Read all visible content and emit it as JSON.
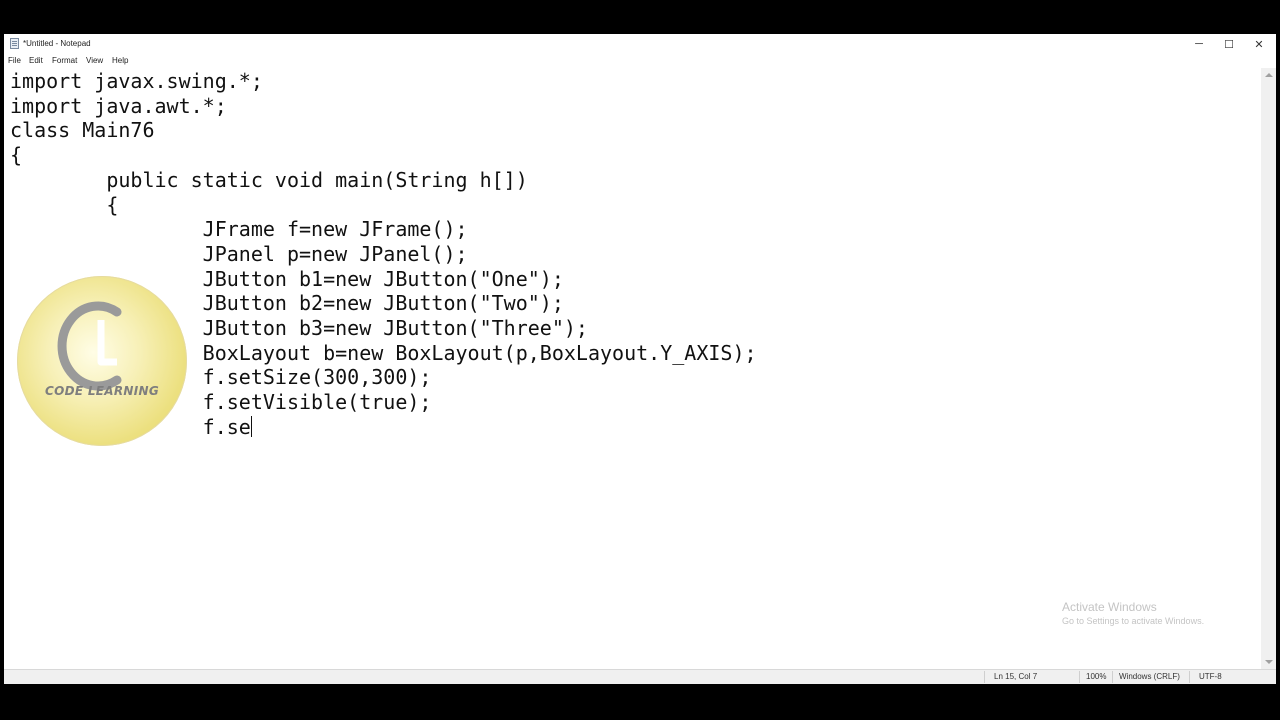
{
  "window": {
    "title": "*Untitled - Notepad"
  },
  "controls": {
    "minimize": "─",
    "maximize": "☐",
    "close": "✕"
  },
  "menu": [
    "File",
    "Edit",
    "Format",
    "View",
    "Help"
  ],
  "code_lines": [
    "import javax.swing.*;",
    "import java.awt.*;",
    "class Main76",
    "{",
    "        public static void main(String h[])",
    "        {",
    "                JFrame f=new JFrame();",
    "                JPanel p=new JPanel();",
    "                JButton b1=new JButton(\"One\");",
    "                JButton b2=new JButton(\"Two\");",
    "                JButton b3=new JButton(\"Three\");",
    "                BoxLayout b=new BoxLayout(p,BoxLayout.Y_AXIS);",
    "                f.setSize(300,300);",
    "                f.setVisible(true);",
    "                f.se"
  ],
  "status": {
    "position": "Ln 15, Col 7",
    "zoom": "100%",
    "line_ending": "Windows (CRLF)",
    "encoding": "UTF-8"
  },
  "watermark": {
    "title": "Activate Windows",
    "subtitle": "Go to Settings to activate Windows."
  },
  "logo": {
    "letter_mark": "CL",
    "text": "CODE LEARNING"
  },
  "icons": {
    "app": "notepad-icon",
    "scroll_up": "chevron-up-icon",
    "scroll_down": "chevron-down-icon"
  }
}
